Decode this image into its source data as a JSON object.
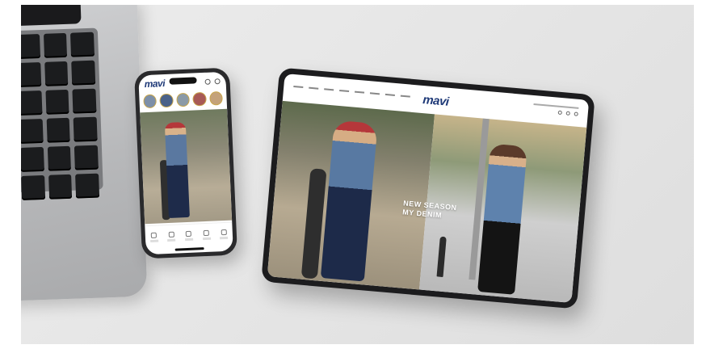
{
  "brand": {
    "logo_text": "mavi",
    "logo_color": "#1f3a78"
  },
  "phone": {
    "stories_count_label": "",
    "hero_alt": "model in denim jacket and jeans"
  },
  "tablet": {
    "hero_tagline_line1": "NEW SEASON",
    "hero_tagline_line2": "MY DENIM"
  },
  "colors": {
    "background": "#e6e6e6",
    "device_frame": "#1c1c1e",
    "accent": "#b5373a"
  }
}
